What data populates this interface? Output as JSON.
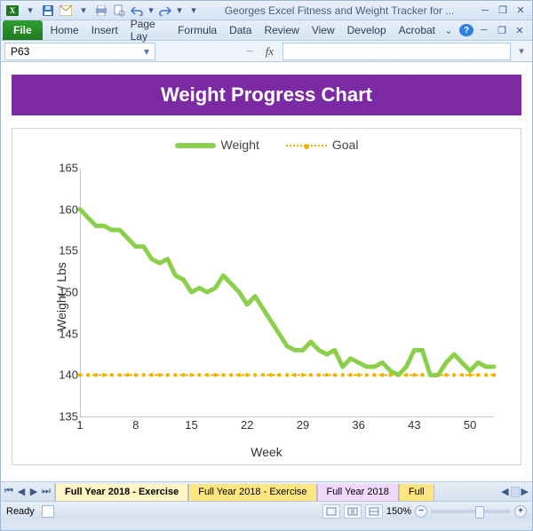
{
  "window": {
    "doc_title": "Georges Excel Fitness and Weight Tracker for ..."
  },
  "ribbon": {
    "file": "File",
    "tabs": [
      "Home",
      "Insert",
      "Page Lay",
      "Formula",
      "Data",
      "Review",
      "View",
      "Develop",
      "Acrobat"
    ]
  },
  "name_box": "P63",
  "fx_label": "fx",
  "chart_data": {
    "type": "line",
    "title": "Weight Progress Chart",
    "xlabel": "Week",
    "ylabel": "Weight / Lbs",
    "ylim": [
      135,
      165
    ],
    "yticks": [
      135,
      140,
      145,
      150,
      155,
      160,
      165
    ],
    "xticks": [
      1,
      8,
      15,
      22,
      29,
      36,
      43,
      50
    ],
    "xrange": [
      1,
      53
    ],
    "series": [
      {
        "name": "Weight",
        "color": "#8ccf4d",
        "x": [
          1,
          2,
          3,
          4,
          5,
          6,
          7,
          8,
          9,
          10,
          11,
          12,
          13,
          14,
          15,
          16,
          17,
          18,
          19,
          20,
          21,
          22,
          23,
          24,
          25,
          26,
          27,
          28,
          29,
          30,
          31,
          32,
          33,
          34,
          35,
          36,
          37,
          38,
          39,
          40,
          41,
          42,
          43,
          44,
          45,
          46,
          47,
          48,
          49,
          50,
          51,
          52,
          53
        ],
        "y": [
          160,
          159,
          158,
          158,
          157.5,
          157.5,
          156.5,
          155.5,
          155.5,
          154,
          153.5,
          154,
          152,
          151.5,
          150,
          150.5,
          150,
          150.5,
          152,
          151,
          150,
          148.5,
          149.5,
          148,
          146.5,
          145,
          143.5,
          143,
          143,
          144,
          143,
          142.5,
          143,
          141,
          142,
          141.5,
          141,
          141,
          141.5,
          140.5,
          140,
          141,
          143,
          143,
          140,
          140,
          141.5,
          142.5,
          141.5,
          140.5,
          141.5,
          141,
          141
        ]
      },
      {
        "name": "Goal",
        "color": "#f2b200",
        "style": "dotted",
        "x": [
          1,
          53
        ],
        "y": [
          140,
          140
        ]
      }
    ]
  },
  "sheet_tabs": [
    "Full Year 2018 - Exercise",
    "Full Year 2018 - Exercise",
    "Full Year 2018",
    "Full"
  ],
  "status": {
    "text": "Ready",
    "zoom": "150%"
  }
}
